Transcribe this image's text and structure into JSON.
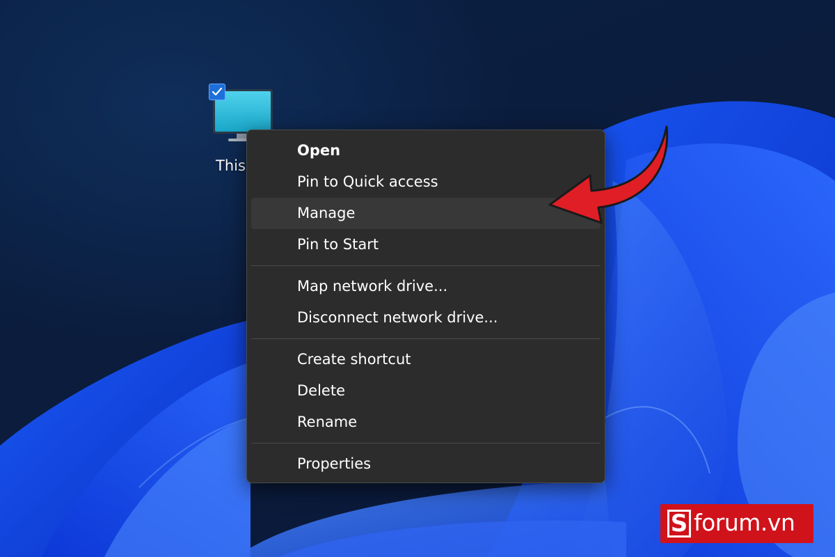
{
  "desktop": {
    "icon": {
      "label": "This PC",
      "selected": true,
      "icon_name": "this-pc-monitor-icon"
    }
  },
  "context_menu": {
    "groups": [
      [
        {
          "label": "Open",
          "bold": true
        },
        {
          "label": "Pin to Quick access"
        },
        {
          "label": "Manage",
          "highlighted": true
        },
        {
          "label": "Pin to Start"
        }
      ],
      [
        {
          "label": "Map network drive..."
        },
        {
          "label": "Disconnect network drive..."
        }
      ],
      [
        {
          "label": "Create shortcut"
        },
        {
          "label": "Delete"
        },
        {
          "label": "Rename"
        }
      ],
      [
        {
          "label": "Properties"
        }
      ]
    ]
  },
  "annotation": {
    "arrow_color": "#e01e26",
    "arrow_target": "Manage"
  },
  "watermark": {
    "logo_letter": "S",
    "text": "forum.vn",
    "color": "#d0121b"
  },
  "colors": {
    "menu_bg": "#2c2c2c",
    "menu_hover": "#383838",
    "selection_blue": "#1e6fd9"
  }
}
